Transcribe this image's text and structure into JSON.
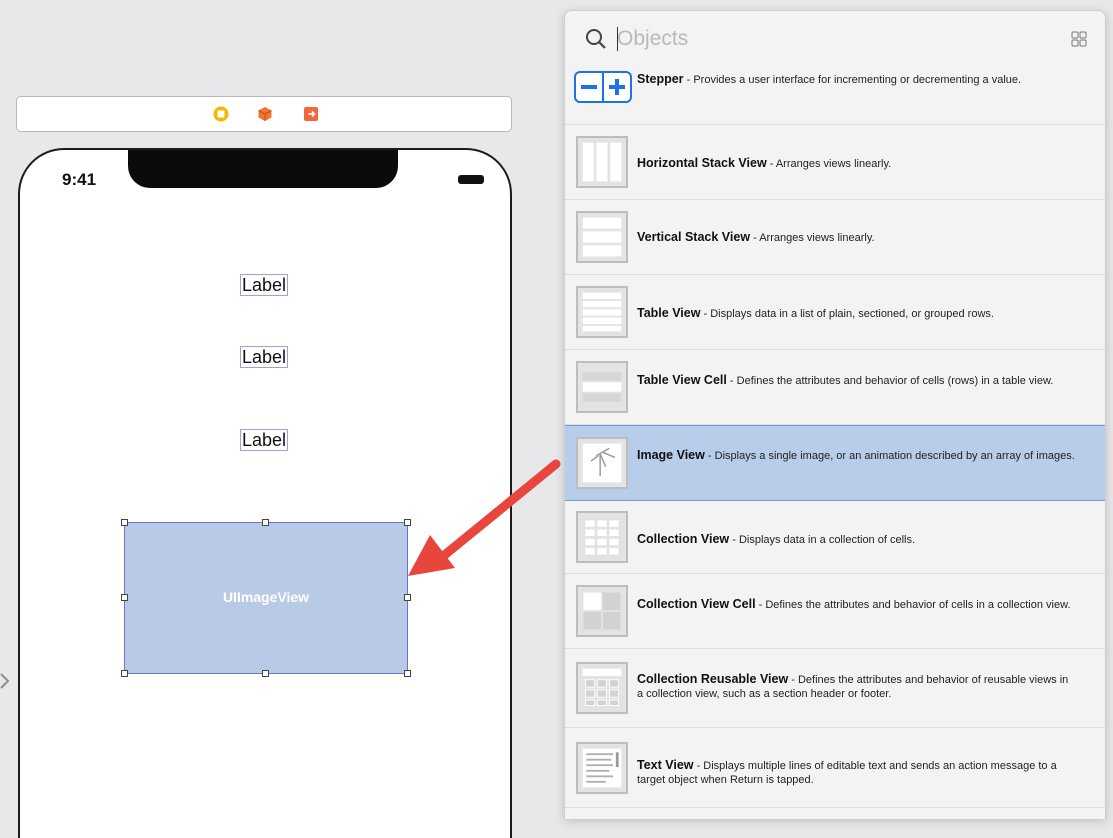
{
  "canvas": {
    "status_time": "9:41",
    "labels": [
      "Label",
      "Label",
      "Label"
    ],
    "image_view_label": "UIImageView"
  },
  "library": {
    "search_placeholder": "Objects",
    "items": [
      {
        "name": "Stepper",
        "desc": "Provides a user interface for incrementing or decrementing a value.",
        "icon": "stepper-icon"
      },
      {
        "name": "Horizontal Stack View",
        "desc": "Arranges views linearly.",
        "icon": "horizontal-stack-icon"
      },
      {
        "name": "Vertical Stack View",
        "desc": "Arranges views linearly.",
        "icon": "vertical-stack-icon"
      },
      {
        "name": "Table View",
        "desc": "Displays data in a list of plain, sectioned, or grouped rows.",
        "icon": "table-view-icon"
      },
      {
        "name": "Table View Cell",
        "desc": "Defines the attributes and behavior of cells (rows) in a table view.",
        "icon": "table-cell-icon"
      },
      {
        "name": "Image View",
        "desc": "Displays a single image, or an animation described by an array of images.",
        "icon": "image-view-icon",
        "selected": true
      },
      {
        "name": "Collection View",
        "desc": "Displays data in a collection of cells.",
        "icon": "collection-view-icon"
      },
      {
        "name": "Collection View Cell",
        "desc": "Defines the attributes and behavior of cells in a collection view.",
        "icon": "collection-cell-icon"
      },
      {
        "name": "Collection Reusable View",
        "desc": "Defines the attributes and behavior of reusable views in a collection view, such as a section header or footer.",
        "icon": "reusable-view-icon"
      },
      {
        "name": "Text View",
        "desc": "Displays multiple lines of editable text and sends an action message to a target object when Return is tapped.",
        "icon": "text-view-icon"
      }
    ]
  },
  "colors": {
    "selection": "#b7cde9",
    "image_view_fill": "#b8cae6",
    "arrow": "#e8463c",
    "stepper_blue": "#1a73e8"
  }
}
